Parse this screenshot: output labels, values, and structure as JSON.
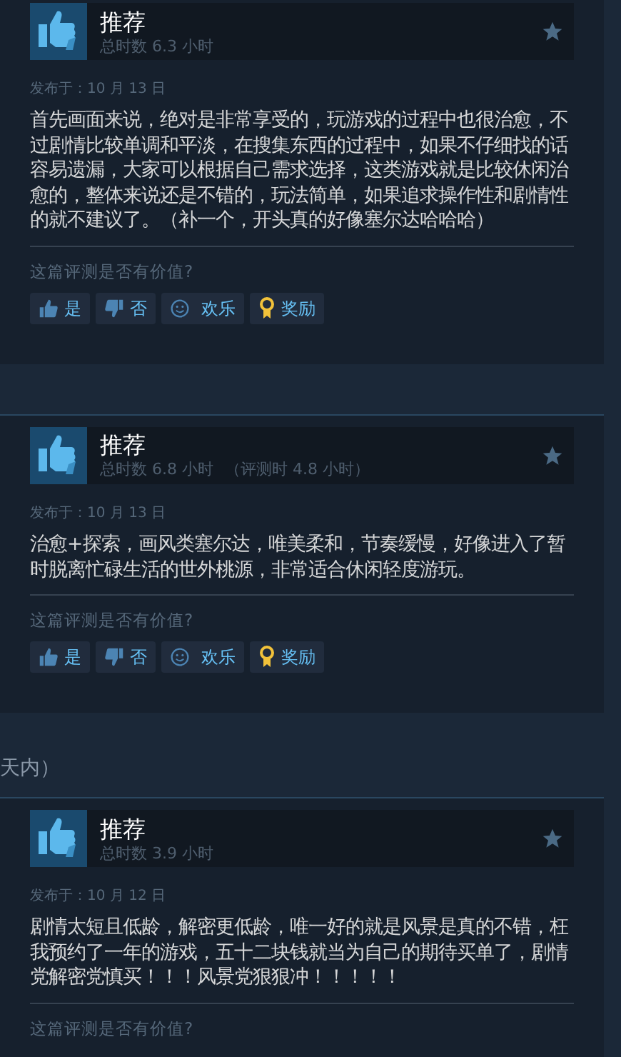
{
  "sections": [
    {
      "kind": "review",
      "recommendation": "推荐",
      "hours": "总时数 6.3 小时",
      "posted": "发布于：10 月 13 日",
      "text": "首先画面来说，绝对是非常享受的，玩游戏的过程中也很治愈，不过剧情比较单调和平淡，在搜集东西的过程中，如果不仔细找的话容易遗漏，大家可以根据自己需求选择，这类游戏就是比较休闲治愈的，整体来说还是不错的，玩法简单，如果追求操作性和剧情性的就不建议了。（补一个，开头真的好像塞尔达哈哈哈）",
      "question": "这篇评测是否有价值?",
      "buttons": [
        {
          "kind": "yes",
          "label": "是"
        },
        {
          "kind": "no",
          "label": "否"
        },
        {
          "kind": "funny",
          "label": "欢乐"
        },
        {
          "kind": "award",
          "label": "奖励"
        }
      ]
    },
    {
      "kind": "review",
      "recommendation": "推荐",
      "hours": "总时数 6.8 小时",
      "review_hours": "（评测时 4.8 小时）",
      "posted": "发布于：10 月 13 日",
      "text": "治愈+探索，画风类塞尔达，唯美柔和，节奏缓慢，好像进入了暂时脱离忙碌生活的世外桃源，非常适合休闲轻度游玩。",
      "question": "这篇评测是否有价值?",
      "buttons": [
        {
          "kind": "yes",
          "label": "是"
        },
        {
          "kind": "no",
          "label": "否"
        },
        {
          "kind": "funny",
          "label": "欢乐"
        },
        {
          "kind": "award",
          "label": "奖励"
        }
      ]
    },
    {
      "kind": "heading",
      "text": "天内）"
    },
    {
      "kind": "review",
      "recommendation": "推荐",
      "hours": "总时数 3.9 小时",
      "posted": "发布于：10 月 12 日",
      "text": "剧情太短且低龄，解密更低龄，唯一好的就是风景是真的不错，枉我预约了一年的游戏，五十二块钱就当为自己的期待买单了，剧情党解密党慎买！！！风景党狠狠冲！！！！！",
      "question": "这篇评测是否有价值?"
    }
  ]
}
